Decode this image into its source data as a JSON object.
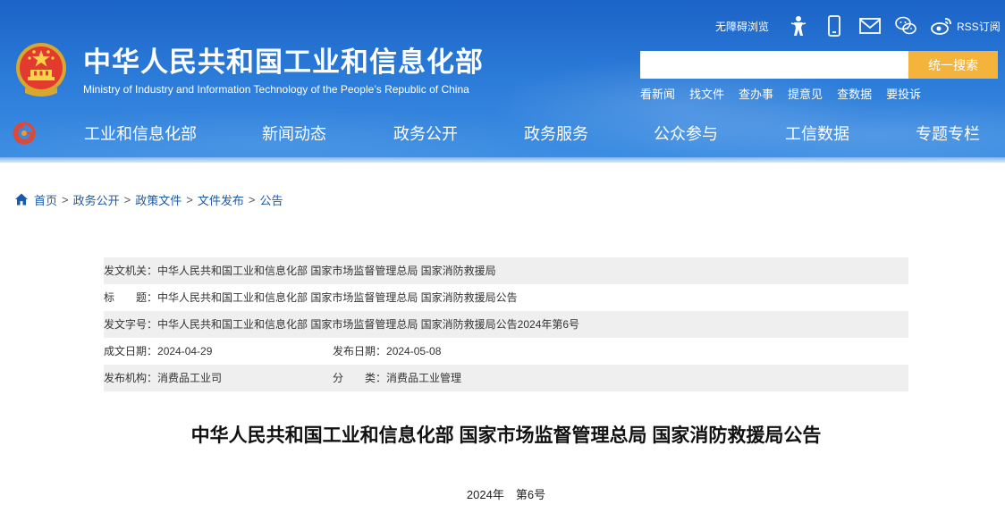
{
  "header": {
    "site_title": "中华人民共和国工业和信息化部",
    "site_subtitle": "Ministry of Industry and Information Technology of the People’s Republic of China",
    "accessibility_label": "无障碍浏览",
    "rss_label": "RSS订阅",
    "search": {
      "placeholder": "",
      "value": "",
      "button_label": "统一搜索"
    },
    "quick_links": [
      "看新闻",
      "找文件",
      "查办事",
      "提意见",
      "查数据",
      "要投诉"
    ],
    "colors": {
      "header_blue": "#2a7ad8",
      "search_button": "#f4b33a"
    },
    "tool_icons": [
      "accessibility-icon",
      "mobile-icon",
      "mail-icon",
      "wechat-icon",
      "weibo-icon"
    ]
  },
  "nav": {
    "items": [
      "工业和信息化部",
      "新闻动态",
      "政务公开",
      "政务服务",
      "公众参与",
      "工信数据",
      "专题专栏"
    ]
  },
  "breadcrumb": [
    "首页",
    "政务公开",
    "政策文件",
    "文件发布",
    "公告"
  ],
  "meta": {
    "issuer_label": "发文机关：",
    "issuer": "中华人民共和国工业和信息化部 国家市场监督管理总局 国家消防救援局",
    "title_label": "标　　题：",
    "title": "中华人民共和国工业和信息化部 国家市场监督管理总局 国家消防救援局公告",
    "doc_no_label": "发文字号：",
    "doc_no": "中华人民共和国工业和信息化部 国家市场监督管理总局 国家消防救援局公告2024年第6号",
    "created_label": "成文日期：",
    "created": "2024-04-29",
    "published_label": "发布日期：",
    "published": "2024-05-08",
    "org_label": "发布机构：",
    "org": "消费品工业司",
    "category_label": "分　　类：",
    "category": "消费品工业管理"
  },
  "article": {
    "title": "中华人民共和国工业和信息化部 国家市场监督管理总局 国家消防救援局公告",
    "doc_number": "2024年　第6号"
  }
}
